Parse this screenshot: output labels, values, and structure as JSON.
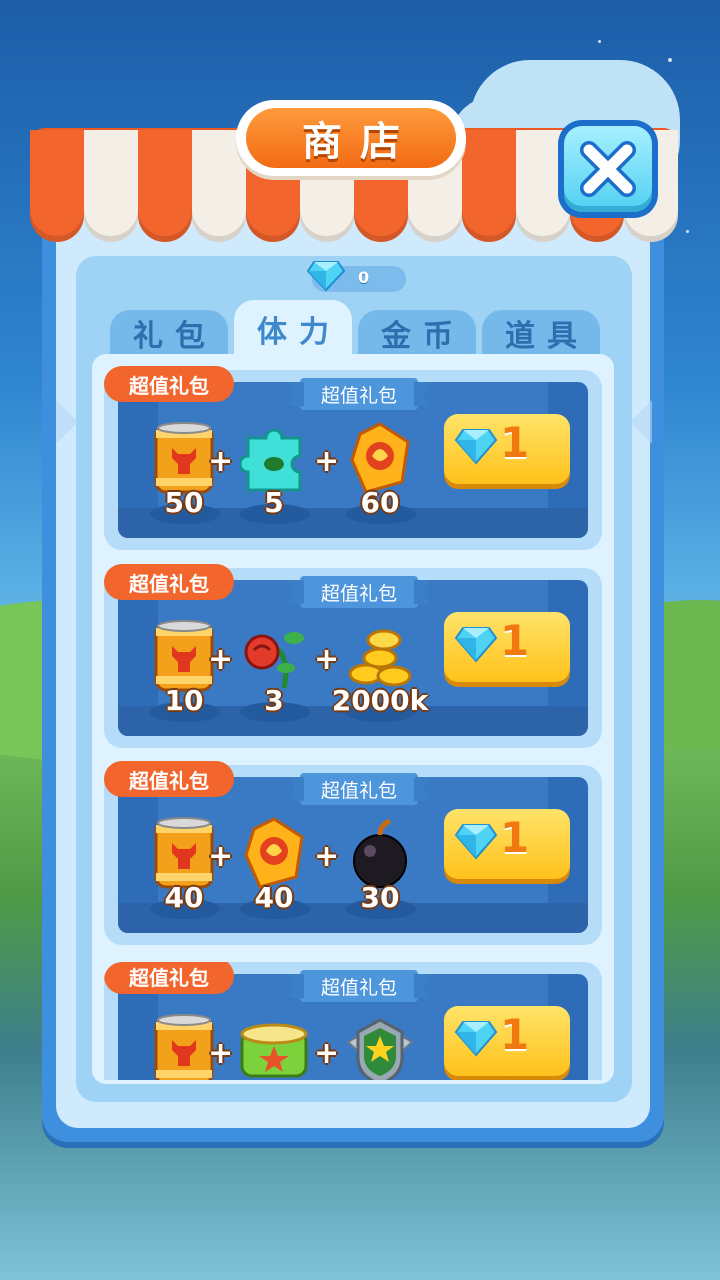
{
  "shop": {
    "title": "商店",
    "gem_balance": "0"
  },
  "tabs": [
    {
      "label": "礼包"
    },
    {
      "label": "体力"
    },
    {
      "label": "金币"
    },
    {
      "label": "道具"
    }
  ],
  "active_tab": "体力",
  "packs": [
    {
      "tag": "超值礼包",
      "banner": "超值礼包",
      "items": [
        {
          "icon": "energy-can-icon",
          "qty": "50"
        },
        {
          "icon": "puzzle-piece-icon",
          "qty": "5"
        },
        {
          "icon": "fire-gem-icon",
          "qty": "60"
        }
      ],
      "price": "1"
    },
    {
      "tag": "超值礼包",
      "banner": "超值礼包",
      "items": [
        {
          "icon": "energy-can-icon",
          "qty": "10"
        },
        {
          "icon": "rose-icon",
          "qty": "3"
        },
        {
          "icon": "gold-coins-icon",
          "qty": "2000k"
        }
      ],
      "price": "1"
    },
    {
      "tag": "超值礼包",
      "banner": "超值礼包",
      "items": [
        {
          "icon": "energy-can-icon",
          "qty": "40"
        },
        {
          "icon": "fire-gem-icon",
          "qty": "40"
        },
        {
          "icon": "bomb-icon",
          "qty": "30"
        }
      ],
      "price": "1"
    },
    {
      "tag": "超值礼包",
      "banner": "超值礼包",
      "items": [
        {
          "icon": "energy-can-icon",
          "qty": ""
        },
        {
          "icon": "food-can-icon",
          "qty": ""
        },
        {
          "icon": "star-badge-icon",
          "qty": ""
        }
      ],
      "price": "1"
    }
  ],
  "colors": {
    "accent_orange": "#f2652d",
    "panel_blue": "#3e8fdd",
    "button_gold": "#ffc21a",
    "price_text": "#f07a10"
  }
}
